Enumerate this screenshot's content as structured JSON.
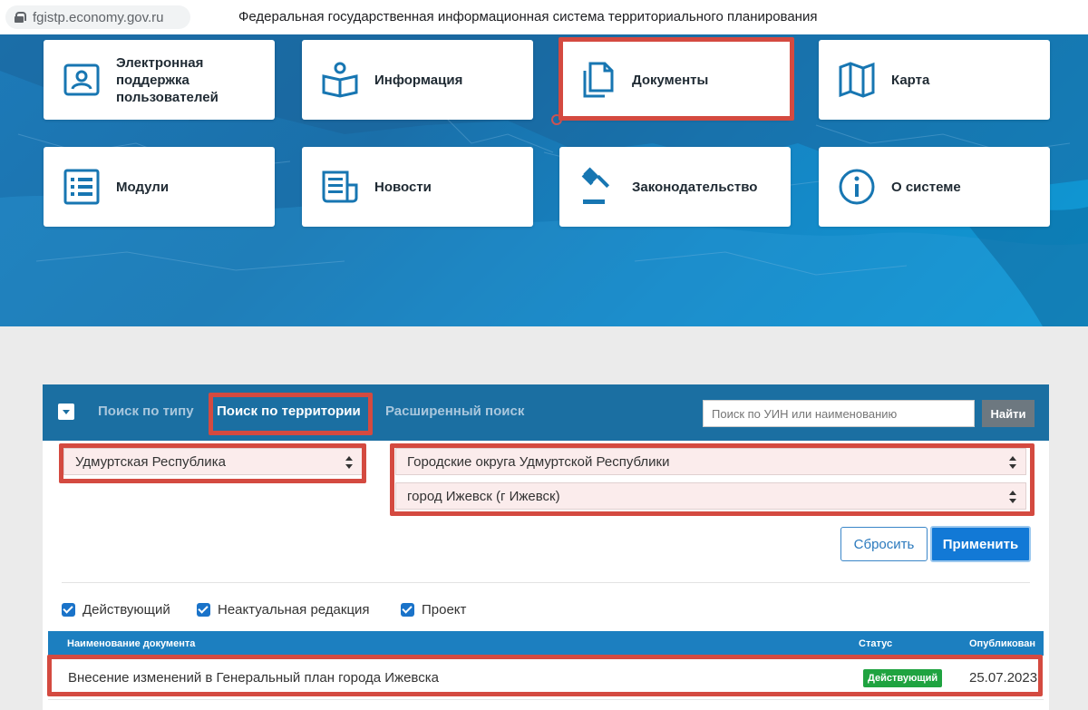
{
  "browser": {
    "url": "fgistp.economy.gov.ru",
    "page_title": "Федеральная государственная информационная система территориального планирования"
  },
  "tiles": [
    {
      "label": "Электронная поддержка пользователей",
      "icon": "user-card-icon"
    },
    {
      "label": "Информация",
      "icon": "reader-book-icon"
    },
    {
      "label": "Документы",
      "icon": "documents-copy-icon"
    },
    {
      "label": "Карта",
      "icon": "map-icon"
    },
    {
      "label": "Модули",
      "icon": "list-icon"
    },
    {
      "label": "Новости",
      "icon": "newspaper-icon"
    },
    {
      "label": "Законодательство",
      "icon": "gavel-icon"
    },
    {
      "label": "О системе",
      "icon": "info-icon"
    }
  ],
  "search": {
    "tabs": [
      "Поиск по типу",
      "Поиск по территории",
      "Расширенный поиск"
    ],
    "active_tab": "Поиск по территории",
    "input_placeholder": "Поиск по УИН или наименованию",
    "find_button": "Найти",
    "region_select": "Удмуртская Республика",
    "district_select": "Городские округа Удмуртской Республики",
    "city_select": "город Ижевск (г Ижевск)",
    "reset_button": "Сбросить",
    "apply_button": "Применить",
    "filters": [
      "Действующий",
      "Неактуальная редакция",
      "Проект"
    ]
  },
  "table": {
    "columns": [
      "Наименование документа",
      "Статус",
      "Опубликован"
    ],
    "rows": [
      {
        "name": "Внесение изменений в Генеральный план города Ижевска",
        "status": "Действующий",
        "published": "25.07.2023"
      }
    ]
  },
  "colors": {
    "highlight": "#d44a40",
    "header_blue": "#1b6fa2",
    "apply_blue": "#1279d6",
    "status_green": "#1fa340"
  }
}
